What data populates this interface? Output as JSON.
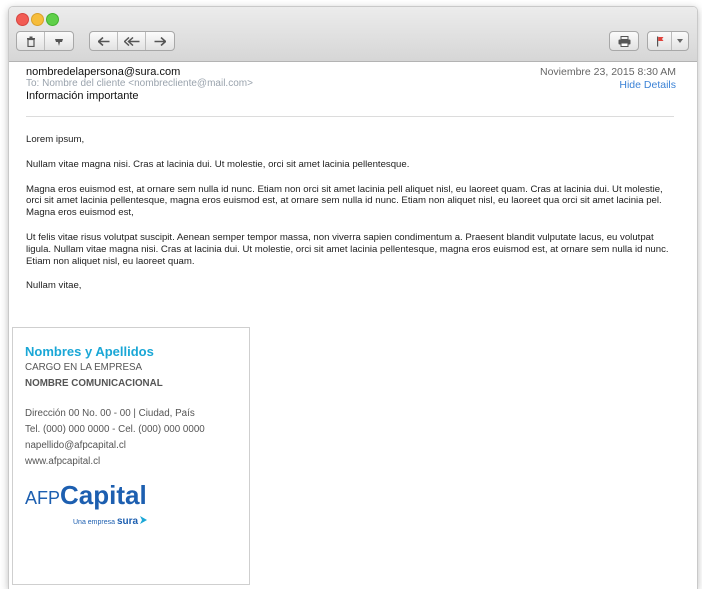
{
  "toolbar": {
    "icons": [
      "trash-icon",
      "junk-icon",
      "reply-icon",
      "reply-all-icon",
      "forward-icon",
      "print-icon",
      "flag-icon",
      "chevron-down-icon"
    ]
  },
  "header": {
    "from": "nombredelapersona@sura.com",
    "to": "To: Nombre del cliente <nombrecliente@mail.com>",
    "subject": "Información importante",
    "date": "Noviembre 23, 2015 8:30 AM",
    "hide_details": "Hide Details"
  },
  "body": {
    "p1": "Lorem ipsum,",
    "p2": "Nullam vitae magna nisi. Cras at lacinia dui. Ut molestie, orci sit amet lacinia pellentesque.",
    "p3": "Magna eros euismod est, at ornare sem nulla id nunc. Etiam non orci sit amet lacinia pell aliquet nisl, eu laoreet quam. Cras at lacinia dui. Ut molestie, orci sit amet lacinia pellentesque, magna eros euismod est, at ornare sem nulla id nunc. Etiam non aliquet nisl, eu laoreet qua orci sit amet lacinia pel. Magna eros euismod est,",
    "p4": "Ut felis vitae risus volutpat suscipit. Aenean semper tempor massa, non viverra sapien condimentum a. Praesent blandit vulputate lacus, eu volutpat ligula. Nullam vitae magna nisi. Cras at lacinia dui. Ut molestie, orci sit amet lacinia pellentesque, magna eros euismod est, at ornare sem nulla id nunc. Etiam non aliquet nisl, eu laoreet quam.",
    "p5": "Nullam vitae,"
  },
  "signature": {
    "name": "Nombres y Apellidos",
    "position": "CARGO EN LA EMPRESA",
    "comm_name": "NOMBRE COMUNICACIONAL",
    "address": "Dirección 00 No. 00 - 00 | Ciudad, País",
    "phone": "Tel. (000) 000 0000 - Cel. (000) 000 0000",
    "email": "napellido@afpcapital.cl",
    "website": "www.afpcapital.cl",
    "logo_afp": "AFP",
    "logo_capital": "Capital",
    "logo_tagline": "Una empresa",
    "logo_sura": "sura"
  },
  "colors": {
    "accent": "#1aa7d6",
    "logo": "#1d5fb0",
    "link": "#3b82d6"
  }
}
